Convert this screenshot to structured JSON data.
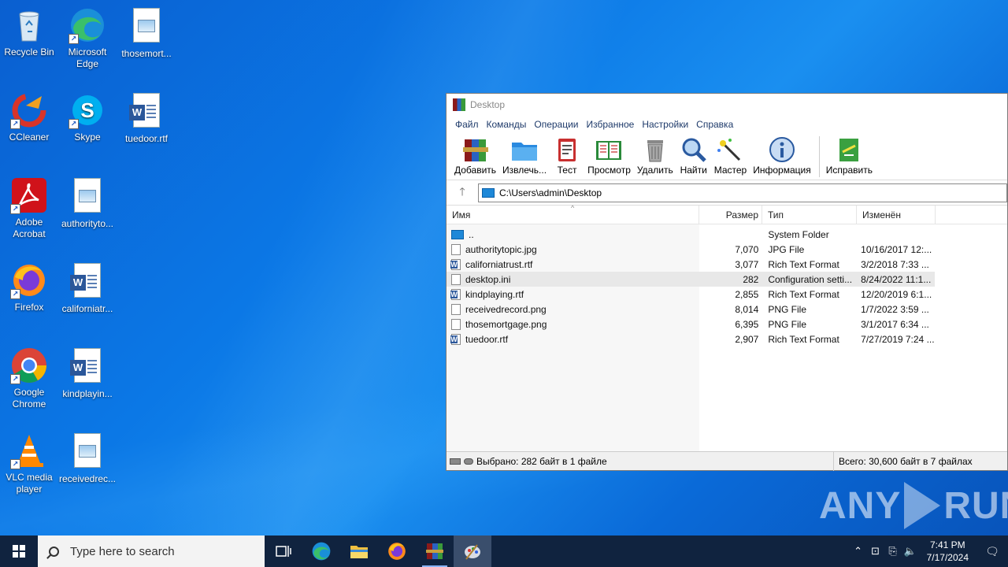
{
  "desktop": {
    "icons": [
      {
        "label": "Recycle Bin"
      },
      {
        "label": "Microsoft Edge"
      },
      {
        "label": "thosemort..."
      },
      {
        "label": "CCleaner"
      },
      {
        "label": "Skype"
      },
      {
        "label": "tuedoor.rtf"
      },
      {
        "label": "Adobe Acrobat"
      },
      {
        "label": "authorityto..."
      },
      {
        "label": "Firefox"
      },
      {
        "label": "californiatr..."
      },
      {
        "label": "Google Chrome"
      },
      {
        "label": "kindplayin..."
      },
      {
        "label": "VLC media player"
      },
      {
        "label": "receivedrec..."
      }
    ]
  },
  "window": {
    "title": "Desktop",
    "menu": [
      "Файл",
      "Команды",
      "Операции",
      "Избранное",
      "Настройки",
      "Справка"
    ],
    "toolbar": [
      {
        "label": "Добавить",
        "icon": "add-archive-icon"
      },
      {
        "label": "Извлечь...",
        "icon": "extract-folder-icon"
      },
      {
        "label": "Тест",
        "icon": "test-clipboard-icon"
      },
      {
        "label": "Просмотр",
        "icon": "view-book-icon"
      },
      {
        "label": "Удалить",
        "icon": "trash-icon"
      },
      {
        "label": "Найти",
        "icon": "find-magnifier-icon"
      },
      {
        "label": "Мастер",
        "icon": "wizard-wand-icon"
      },
      {
        "label": "Информация",
        "icon": "info-icon"
      },
      {
        "label": "Исправить",
        "icon": "repair-icon"
      }
    ],
    "address": "C:\\Users\\admin\\Desktop",
    "columns": [
      "Имя",
      "Размер",
      "Тип",
      "Изменён"
    ],
    "files": [
      {
        "name": "..",
        "size": "",
        "type": "System Folder",
        "modified": "",
        "kind": "up"
      },
      {
        "name": "authoritytopic.jpg",
        "size": "7,070",
        "type": "JPG File",
        "modified": "10/16/2017 12:...",
        "kind": "img"
      },
      {
        "name": "californiatrust.rtf",
        "size": "3,077",
        "type": "Rich Text Format",
        "modified": "3/2/2018 7:33 ...",
        "kind": "rtf"
      },
      {
        "name": "desktop.ini",
        "size": "282",
        "type": "Configuration setti...",
        "modified": "8/24/2022 11:1...",
        "kind": "ini"
      },
      {
        "name": "kindplaying.rtf",
        "size": "2,855",
        "type": "Rich Text Format",
        "modified": "12/20/2019 6:1...",
        "kind": "rtf"
      },
      {
        "name": "receivedrecord.png",
        "size": "8,014",
        "type": "PNG File",
        "modified": "1/7/2022 3:59 ...",
        "kind": "img"
      },
      {
        "name": "thosemortgage.png",
        "size": "6,395",
        "type": "PNG File",
        "modified": "3/1/2017 6:34 ...",
        "kind": "img"
      },
      {
        "name": "tuedoor.rtf",
        "size": "2,907",
        "type": "Rich Text Format",
        "modified": "7/27/2019 7:24 ...",
        "kind": "rtf"
      }
    ],
    "selected_index": 3,
    "status_left": "Выбрано: 282 байт в 1 файле",
    "status_right": "Всего: 30,600 байт в 7 файлах"
  },
  "watermark": {
    "left": "ANY",
    "right": "RUN"
  },
  "taskbar": {
    "search_placeholder": "Type here to search",
    "time": "7:41 PM",
    "date": "7/17/2024"
  }
}
